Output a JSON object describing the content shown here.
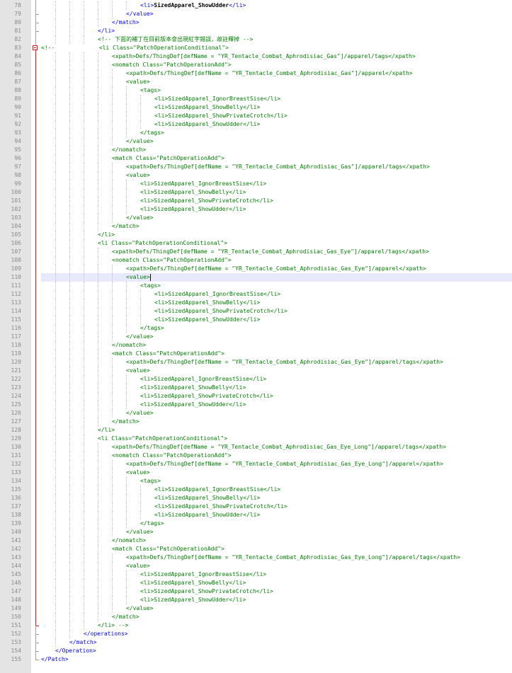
{
  "editor": {
    "first_line": 78,
    "current_line": 110,
    "lines": [
      "\t\t\t\t\t\t\t<li>SizedApparel_ShowUdder</li>",
      "\t\t\t\t\t\t</value>",
      "\t\t\t\t\t</match>",
      "\t\t\t\t</li>",
      "\t\t\t\t<!-- 下面的補丁在目前版本會出現紅字錯誤，故註釋掉 -->",
      "<!--\t\t\t\t<li Class=\"PatchOperationConditional\">",
      "\t\t\t\t\t<xpath>Defs/ThingDef[defName = \"YR_Tentacle_Combat_Aphrodisiac_Gas\"]/apparel/tags</xpath>",
      "\t\t\t\t\t<nomatch Class=\"PatchOperationAdd\">",
      "\t\t\t\t\t\t<xpath>Defs/ThingDef[defName = \"YR_Tentacle_Combat_Aphrodisiac_Gas\"]/apparel</xpath>",
      "\t\t\t\t\t\t<value>",
      "\t\t\t\t\t\t\t<tags>",
      "\t\t\t\t\t\t\t\t<li>SizedApparel_IgnorBreastSise</li>",
      "\t\t\t\t\t\t\t\t<li>SizedApparel_ShowBelly</li>",
      "\t\t\t\t\t\t\t\t<li>SizedApparel_ShowPrivateCrotch</li>",
      "\t\t\t\t\t\t\t\t<li>SizedApparel_ShowUdder</li>",
      "\t\t\t\t\t\t\t</tags>",
      "\t\t\t\t\t\t</value>",
      "\t\t\t\t\t</nomatch>",
      "\t\t\t\t\t<match Class=\"PatchOperationAdd\">",
      "\t\t\t\t\t\t<xpath>Defs/ThingDef[defName = \"YR_Tentacle_Combat_Aphrodisiac_Gas\"]/apparel/tags</xpath>",
      "\t\t\t\t\t\t<value>",
      "\t\t\t\t\t\t\t<li>SizedApparel_IgnorBreastSise</li>",
      "\t\t\t\t\t\t\t<li>SizedApparel_ShowBelly</li>",
      "\t\t\t\t\t\t\t<li>SizedApparel_ShowPrivateCrotch</li>",
      "\t\t\t\t\t\t\t<li>SizedApparel_ShowUdder</li>",
      "\t\t\t\t\t\t</value>",
      "\t\t\t\t\t</match>",
      "\t\t\t\t</li>",
      "\t\t\t\t<li Class=\"PatchOperationConditional\">",
      "\t\t\t\t\t<xpath>Defs/ThingDef[defName = \"YR_Tentacle_Combat_Aphrodisiac_Gas_Eye\"]/apparel/tags</xpath>",
      "\t\t\t\t\t<nomatch Class=\"PatchOperationAdd\">",
      "\t\t\t\t\t\t<xpath>Defs/ThingDef[defName = \"YR_Tentacle_Combat_Aphrodisiac_Gas_Eye\"]/apparel</xpath>",
      "\t\t\t\t\t\t<value>",
      "\t\t\t\t\t\t\t<tags>",
      "\t\t\t\t\t\t\t\t<li>SizedApparel_IgnorBreastSise</li>",
      "\t\t\t\t\t\t\t\t<li>SizedApparel_ShowBelly</li>",
      "\t\t\t\t\t\t\t\t<li>SizedApparel_ShowPrivateCrotch</li>",
      "\t\t\t\t\t\t\t\t<li>SizedApparel_ShowUdder</li>",
      "\t\t\t\t\t\t\t</tags>",
      "\t\t\t\t\t\t</value>",
      "\t\t\t\t\t</nomatch>",
      "\t\t\t\t\t<match Class=\"PatchOperationAdd\">",
      "\t\t\t\t\t\t<xpath>Defs/ThingDef[defName = \"YR_Tentacle_Combat_Aphrodisiac_Gas_Eye\"]/apparel/tags</xpath>",
      "\t\t\t\t\t\t<value>",
      "\t\t\t\t\t\t\t<li>SizedApparel_IgnorBreastSise</li>",
      "\t\t\t\t\t\t\t<li>SizedApparel_ShowBelly</li>",
      "\t\t\t\t\t\t\t<li>SizedApparel_ShowPrivateCrotch</li>",
      "\t\t\t\t\t\t\t<li>SizedApparel_ShowUdder</li>",
      "\t\t\t\t\t\t</value>",
      "\t\t\t\t\t</match>",
      "\t\t\t\t</li>",
      "\t\t\t\t<li Class=\"PatchOperationConditional\">",
      "\t\t\t\t\t<xpath>Defs/ThingDef[defName = \"YR_Tentacle_Combat_Aphrodisiac_Gas_Eye_Long\"]/apparel/tags</xpath>",
      "\t\t\t\t\t<nomatch Class=\"PatchOperationAdd\">",
      "\t\t\t\t\t\t<xpath>Defs/ThingDef[defName = \"YR_Tentacle_Combat_Aphrodisiac_Gas_Eye_Long\"]/apparel</xpath>",
      "\t\t\t\t\t\t<value>",
      "\t\t\t\t\t\t\t<tags>",
      "\t\t\t\t\t\t\t\t<li>SizedApparel_IgnorBreastSise</li>",
      "\t\t\t\t\t\t\t\t<li>SizedApparel_ShowBelly</li>",
      "\t\t\t\t\t\t\t\t<li>SizedApparel_ShowPrivateCrotch</li>",
      "\t\t\t\t\t\t\t\t<li>SizedApparel_ShowUdder</li>",
      "\t\t\t\t\t\t\t</tags>",
      "\t\t\t\t\t\t</value>",
      "\t\t\t\t\t</nomatch>",
      "\t\t\t\t\t<match Class=\"PatchOperationAdd\">",
      "\t\t\t\t\t\t<xpath>Defs/ThingDef[defName = \"YR_Tentacle_Combat_Aphrodisiac_Gas_Eye_Long\"]/apparel/tags</xpath>",
      "\t\t\t\t\t\t<value>",
      "\t\t\t\t\t\t\t<li>SizedApparel_IgnorBreastSise</li>",
      "\t\t\t\t\t\t\t<li>SizedApparel_ShowBelly</li>",
      "\t\t\t\t\t\t\t<li>SizedApparel_ShowPrivateCrotch</li>",
      "\t\t\t\t\t\t\t<li>SizedApparel_ShowUdder</li>",
      "\t\t\t\t\t\t</value>",
      "\t\t\t\t\t</match>",
      "\t\t\t\t</li> -->",
      "\t\t\t</operations>",
      "\t\t</match>",
      "\t</Operation>",
      "</Patch>"
    ]
  },
  "colors": {
    "tag": "#0000ff",
    "attribute": "#ff0000",
    "attribute_value": "#8000ff",
    "text": "#000000",
    "comment": "#008000",
    "fold_marker": "#d81818",
    "current_line": "#e8e8ff"
  },
  "icons": {
    "fold_collapse": "fold-minus-icon"
  }
}
